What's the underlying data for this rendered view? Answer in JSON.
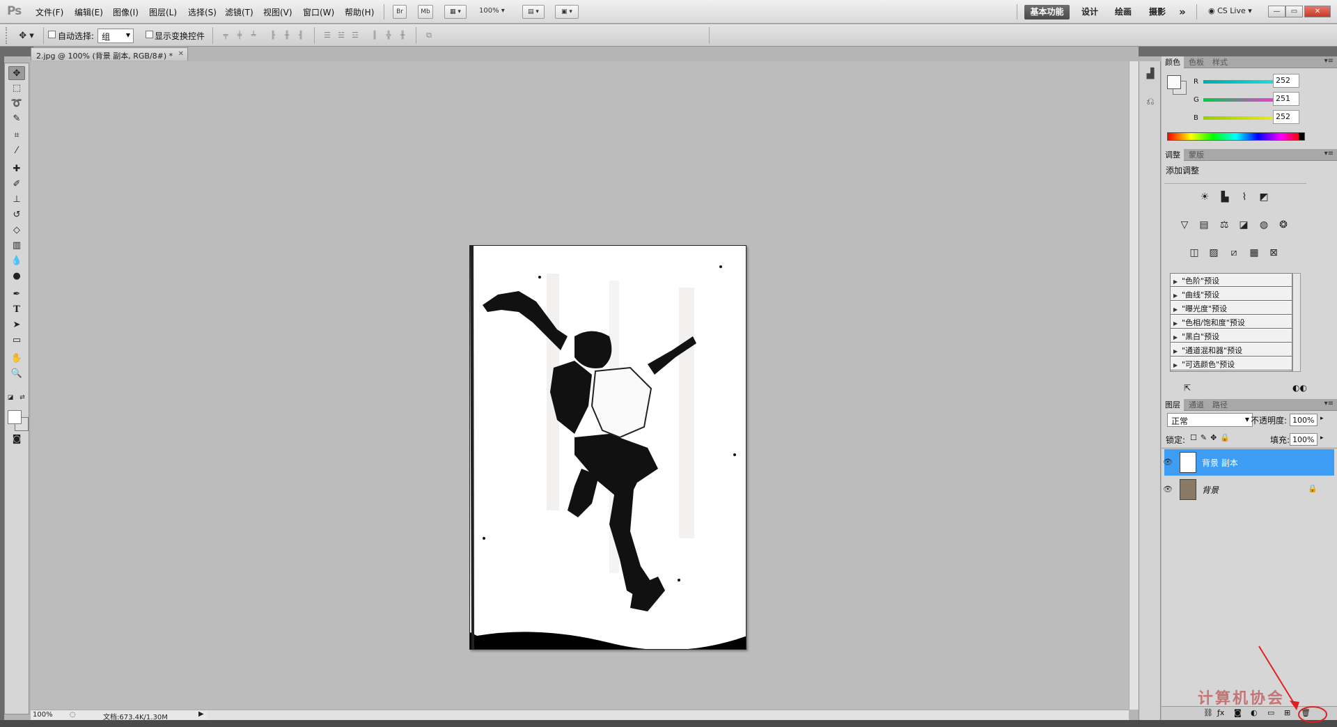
{
  "menubar": {
    "logo": "Ps",
    "items": [
      "文件(F)",
      "编辑(E)",
      "图像(I)",
      "图层(L)",
      "选择(S)",
      "滤镜(T)",
      "视图(V)",
      "窗口(W)",
      "帮助(H)"
    ],
    "br_label": "Br",
    "mb_label": "Mb",
    "zoom": "100%",
    "workspaces": [
      "基本功能",
      "设计",
      "绘画",
      "摄影"
    ],
    "more": "»",
    "cslive": "CS Live",
    "win_min": "—",
    "win_restore": "▭",
    "win_close": "✕"
  },
  "options": {
    "auto_select_label": "自动选择:",
    "auto_select_value": "组",
    "show_transform_label": "显示变换控件"
  },
  "document": {
    "tab_title": "2.jpg @ 100% (背景 副本, RGB/8#) *",
    "close": "✕",
    "status_zoom": "100%",
    "status_doc": "文档:673.4K/1.30M"
  },
  "color_panel": {
    "tabs": [
      "颜色",
      "色板",
      "样式"
    ],
    "r_label": "R",
    "g_label": "G",
    "b_label": "B",
    "r": "252",
    "g": "251",
    "b": "252",
    "colors": {
      "r_slider": "#1fd9d9",
      "g_slider": "#e83fd4",
      "b_slider": "#e8e824"
    }
  },
  "adjust_panel": {
    "tabs": [
      "调整",
      "蒙版"
    ],
    "heading": "添加调整",
    "presets": [
      "\"色阶\"预设",
      "\"曲线\"预设",
      "\"曝光度\"预设",
      "\"色相/饱和度\"预设",
      "\"黑白\"预设",
      "\"通道混和器\"预设",
      "\"可选颜色\"预设"
    ]
  },
  "layers_panel": {
    "tabs": [
      "图层",
      "通道",
      "路径"
    ],
    "blend_mode": "正常",
    "opacity_label": "不透明度:",
    "opacity": "100%",
    "lock_label": "锁定:",
    "fill_label": "填充:",
    "fill": "100%",
    "layers": [
      {
        "name": "背景 副本",
        "selected": true
      },
      {
        "name": "背景",
        "selected": false
      }
    ],
    "selected_color": "#3d9df5"
  },
  "watermark": "计算机协会"
}
